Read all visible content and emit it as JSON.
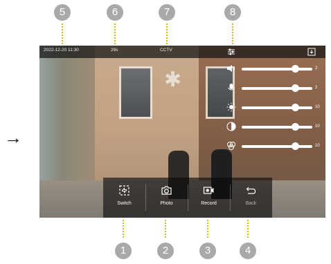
{
  "callouts_top": [
    "5",
    "6",
    "7",
    "8"
  ],
  "callouts_bottom": [
    "1",
    "2",
    "3",
    "4"
  ],
  "indicator_arrow": "→",
  "status_bar": {
    "datetime": "2022-12-20 11:30",
    "duration": "29s",
    "source": "CCTV",
    "settings_icon": "sliders-icon",
    "exit_icon": "exit-icon"
  },
  "sliders": [
    {
      "name": "volume",
      "icon": "speaker-icon",
      "value": "2",
      "level": 0.75
    },
    {
      "name": "microphone",
      "icon": "microphone-icon",
      "value": "2",
      "level": 0.75
    },
    {
      "name": "brightness",
      "icon": "sun-icon",
      "value": "10",
      "level": 0.75
    },
    {
      "name": "contrast",
      "icon": "contrast-icon",
      "value": "10",
      "level": 0.75
    },
    {
      "name": "color",
      "icon": "color-icon",
      "value": "10",
      "level": 0.75
    }
  ],
  "toolbar": {
    "switch_label": "Switch",
    "photo_label": "Photo",
    "record_label": "Record",
    "back_label": "Back"
  }
}
